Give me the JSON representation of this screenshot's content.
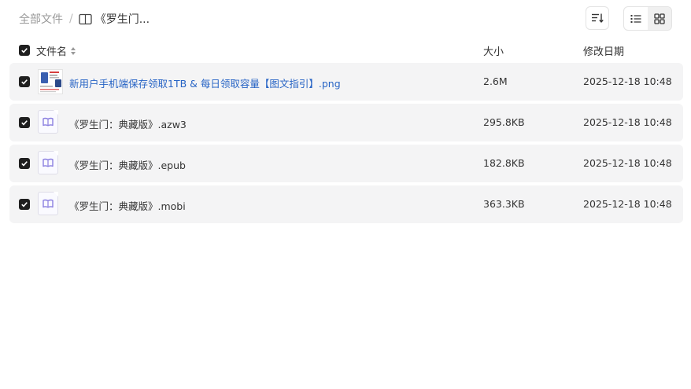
{
  "breadcrumb": {
    "root": "全部文件",
    "separator": "/",
    "current": "《罗生门..."
  },
  "columns": {
    "name": "文件名",
    "size": "大小",
    "modified": "修改日期"
  },
  "files": [
    {
      "name": "新用户手机端保存领取1TB & 每日领取容量【图文指引】.png",
      "size": "2.6M",
      "modified": "2025-12-18 10:48",
      "kind": "image",
      "selected": true
    },
    {
      "name": "《罗生门：典藏版》.azw3",
      "size": "295.8KB",
      "modified": "2025-12-18 10:48",
      "kind": "ebook",
      "selected": true
    },
    {
      "name": "《罗生门：典藏版》.epub",
      "size": "182.8KB",
      "modified": "2025-12-18 10:48",
      "kind": "ebook",
      "selected": true
    },
    {
      "name": "《罗生门：典藏版》.mobi",
      "size": "363.3KB",
      "modified": "2025-12-18 10:48",
      "kind": "ebook",
      "selected": true
    }
  ],
  "colors": {
    "link": "#2764c5",
    "row_bg": "#f4f4f5",
    "checkbox": "#1f1f1f",
    "book_icon": "#8b7fe0"
  }
}
